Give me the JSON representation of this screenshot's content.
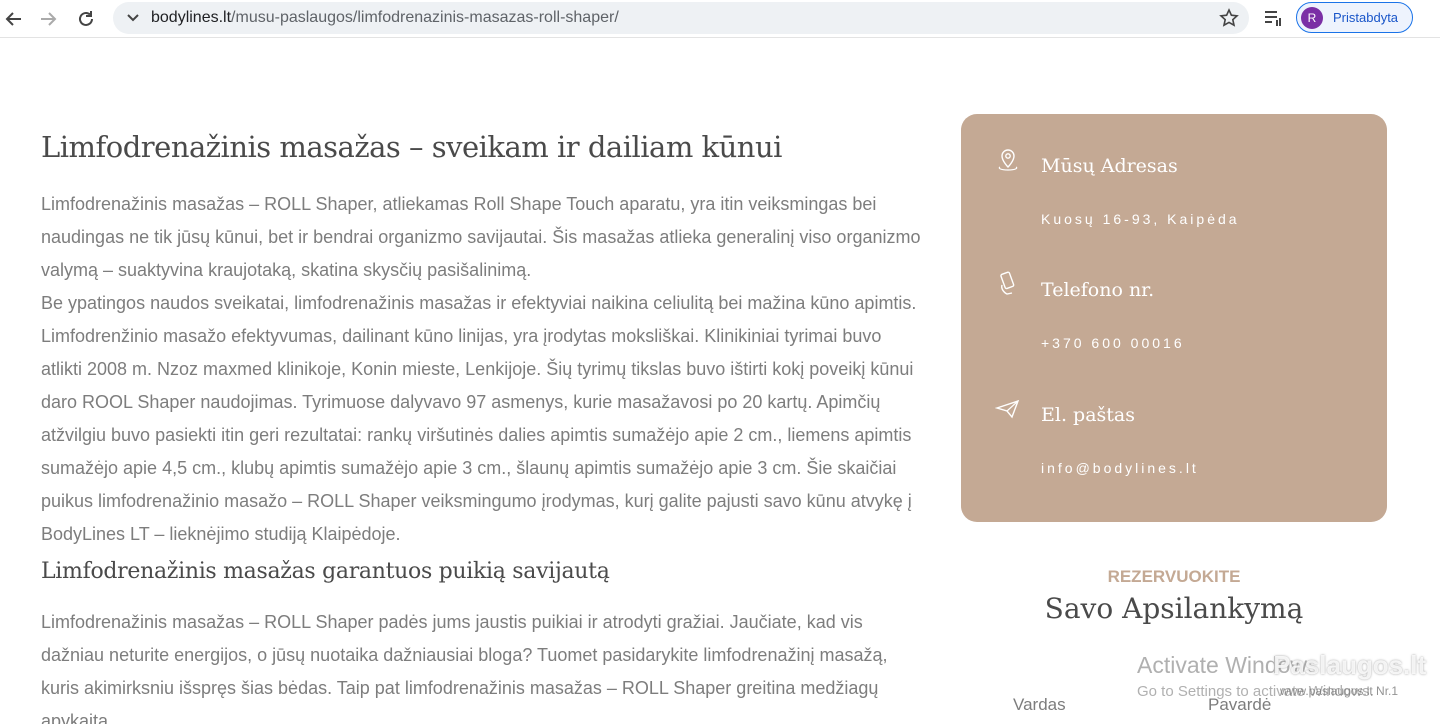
{
  "browser": {
    "url_host": "bodylines.lt",
    "url_path": "/musu-paslaugos/limfodrenazinis-masazas-roll-shaper/",
    "profile_initial": "R",
    "profile_label": "Pristabdyta",
    "icons": [
      "back-icon",
      "forward-icon",
      "reload-icon",
      "chevron-down-icon",
      "star-icon",
      "reading-list-icon"
    ]
  },
  "article": {
    "title": "Limfodrenažinis masažas – sveikam ir dailiam kūnui",
    "paragraph1": "Limfodrenažinis masažas – ROLL Shaper, atliekamas Roll Shape Touch aparatu, yra itin veiksmingas bei naudingas ne tik jūsų kūnui, bet ir bendrai organizmo savijautai. Šis masažas atlieka generalinį viso organizmo valymą – suaktyvina kraujotaką, skatina skysčių pasišalinimą.",
    "paragraph2": "Be ypatingos naudos sveikatai, limfodrenažinis masažas ir efektyviai naikina celiulitą bei mažina kūno apimtis. Limfodrenžinio masažo efektyvumas, dailinant kūno linijas, yra įrodytas moksliškai. Klinikiniai tyrimai buvo atlikti 2008 m. Nzoz maxmed klinikoje, Konin mieste, Lenkijoje. Šių tyrimų tikslas buvo ištirti kokį poveikį kūnui daro ROOL Shaper naudojimas. Tyrimuose dalyvavo 97 asmenys, kurie masažavosi po 20 kartų. Apimčių atžvilgiu buvo pasiekti itin geri rezultatai: rankų viršutinės dalies apimtis sumažėjo apie 2 cm., liemens apimtis sumažėjo apie 4,5 cm., klubų apimtis sumažėjo apie 3 cm., šlaunų apimtis sumažėjo apie 3 cm. Šie skaičiai puikus limfodrenažinio masažo – ROLL Shaper veiksmingumo įrodymas, kurį galite pajusti savo kūnu atvykę į BodyLines LT – lieknėjimo studiją Klaipėdoje.",
    "subtitle": "Limfodrenažinis masažas garantuos puikią savijautą",
    "paragraph3": "Limfodrenažinis masažas – ROLL Shaper padės jums jaustis puikiai ir atrodyti gražiai. Jaučiate, kad vis dažniau neturite energijos, o jūsų nuotaika dažniausiai bloga? Tuomet pasidarykite limfodrenažinį masažą, kuris akimirksniu išspręs šias bėdas. Taip pat limfodrenažinis masažas – ROLL Shaper greitina medžiagų apykaitą,"
  },
  "contact": {
    "address_heading": "Mūsų Adresas",
    "address_value": "Kuosų 16-93, Kaipėda",
    "phone_heading": "Telefono nr.",
    "phone_value": "+370 600 00016",
    "email_heading": "El. paštas",
    "email_value": "info@bodylines.lt",
    "icons": [
      "location-pin-icon",
      "phone-hand-icon",
      "paper-plane-icon"
    ],
    "card_color": "#c4a994"
  },
  "reservation": {
    "kicker": "REZERVUOKITE",
    "title": "Savo Apsilankymą",
    "field_name": "Vardas",
    "field_surname": "Pavardė"
  },
  "overlay": {
    "windows_title": "Activate Windows",
    "windows_sub": "Go to Settings to activate Windows.",
    "watermark_logo": "Paslaugos.lt",
    "watermark_small": "www.paslaugos.lt Nr.1"
  }
}
